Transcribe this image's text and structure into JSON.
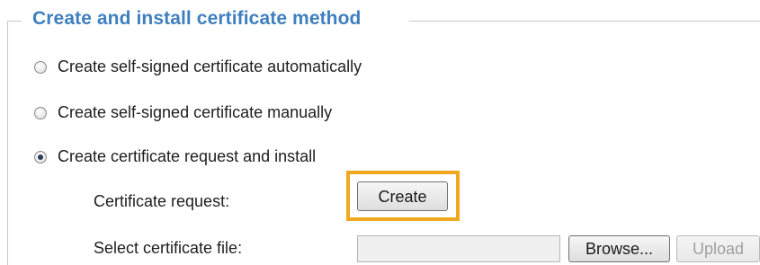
{
  "section": {
    "legend": "Create and install certificate method"
  },
  "options": [
    {
      "label": "Create self-signed certificate automatically",
      "selected": false
    },
    {
      "label": "Create self-signed certificate manually",
      "selected": false
    },
    {
      "label": "Create certificate request and install",
      "selected": true
    }
  ],
  "certificate_request": {
    "label": "Certificate request:",
    "button_label": "Create"
  },
  "select_file": {
    "label": "Select certificate file:",
    "value": "",
    "browse_label": "Browse...",
    "upload_label": "Upload"
  },
  "colors": {
    "legend": "#3f7fbf",
    "highlight": "#f0a81e"
  }
}
